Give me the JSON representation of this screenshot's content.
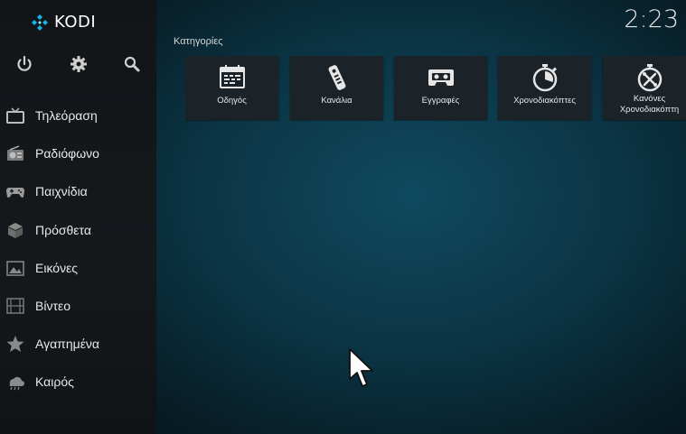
{
  "app": {
    "name": "KODI"
  },
  "clock": "2:23",
  "top_icons": [
    "power-icon",
    "gear-icon",
    "search-icon"
  ],
  "sidebar": {
    "items": [
      {
        "label": "Τηλεόραση",
        "icon": "tv-icon"
      },
      {
        "label": "Ραδιόφωνο",
        "icon": "radio-icon"
      },
      {
        "label": "Παιχνίδια",
        "icon": "gamepad-icon"
      },
      {
        "label": "Πρόσθετα",
        "icon": "addon-box-icon"
      },
      {
        "label": "Εικόνες",
        "icon": "pictures-icon"
      },
      {
        "label": "Βίντεο",
        "icon": "film-icon"
      },
      {
        "label": "Αγαπημένα",
        "icon": "star-icon"
      },
      {
        "label": "Καιρός",
        "icon": "weather-icon"
      }
    ]
  },
  "categories": {
    "title": "Κατηγορίες",
    "tiles": [
      {
        "label": "Οδηγός",
        "icon": "calendar-guide-icon"
      },
      {
        "label": "Κανάλια",
        "icon": "remote-icon"
      },
      {
        "label": "Εγγραφές",
        "icon": "cassette-icon"
      },
      {
        "label": "Χρονοδιακόπτες",
        "icon": "stopwatch-icon"
      },
      {
        "label": "Κανόνες Χρονοδιακόπτη",
        "icon": "timer-rules-icon"
      }
    ]
  },
  "colors": {
    "accent": "#17b2e6",
    "background": "#0b3444",
    "sidebar": "#14181b"
  }
}
